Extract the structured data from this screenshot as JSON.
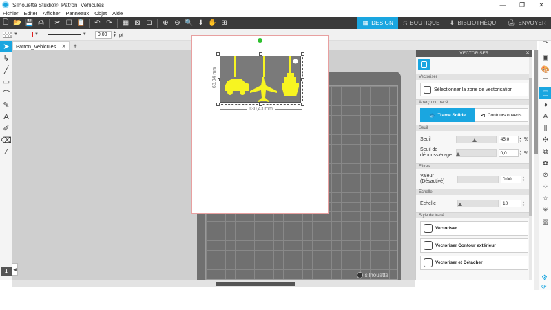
{
  "window": {
    "title": "Silhouette Studio®: Patron_Vehicules",
    "controls": [
      "—",
      "❐",
      "✕"
    ]
  },
  "menu": [
    "Fichier",
    "Editer",
    "Afficher",
    "Panneaux",
    "Objet",
    "Aide"
  ],
  "toolbar": {
    "icons": [
      "new-file-icon",
      "open-icon",
      "save-icon",
      "print-icon",
      "cut-icon",
      "copy-icon",
      "paste-icon",
      "undo-icon",
      "redo-icon",
      "group-icon",
      "ungroup-icon",
      "zoom-in-icon",
      "zoom-out-icon",
      "zoom-fit-icon",
      "move-down-icon",
      "pan-hand-icon",
      "fit-page-icon"
    ]
  },
  "nav_tabs": [
    {
      "label": "DESIGN",
      "active": true
    },
    {
      "label": "BOUTIQUE",
      "active": false
    },
    {
      "label": "BIBLIOTHÈQUI",
      "active": false
    },
    {
      "label": "ENVOYER",
      "active": false
    }
  ],
  "toolbar2": {
    "line_width": "0,00",
    "unit": "pt"
  },
  "document": {
    "tab_label": "Patron_Vehicules",
    "tab_close": "✕",
    "add_tab": "+"
  },
  "canvas": {
    "width_label": "130,43 mm",
    "height_label": "68,04 mm",
    "brand": "silhouette",
    "accent_color": "#1aa6e0",
    "shape_color": "#f7f421"
  },
  "panel": {
    "title": "VECTORISER",
    "sections": {
      "vectoriser": "Vectoriser",
      "apercu": "Aperçu du tracé",
      "seuil": "Seuil",
      "filtres": "Filtres",
      "echelle": "Échelle",
      "style": "Style de tracé"
    },
    "select_area": "Sélectionner la zone de vectorisation",
    "preview_modes": [
      "Trame Solide",
      "Contours ouverts"
    ],
    "seuil_label": "Seuil",
    "seuil_value": "45,0",
    "seuil_unit": "%",
    "seuil_level": 0.45,
    "depoussierage_label": "Seuil de dépoussiérage",
    "depoussierage_value": "0,0",
    "depoussierage_unit": "%",
    "valeur_label": "Valeur (Désactivé)",
    "valeur_value": "0,00",
    "echelle_label": "Échelle",
    "echelle_value": "10",
    "actions": [
      "Vectoriser",
      "Vectoriser Contour extérieur",
      "Vectoriser et Détacher"
    ]
  }
}
